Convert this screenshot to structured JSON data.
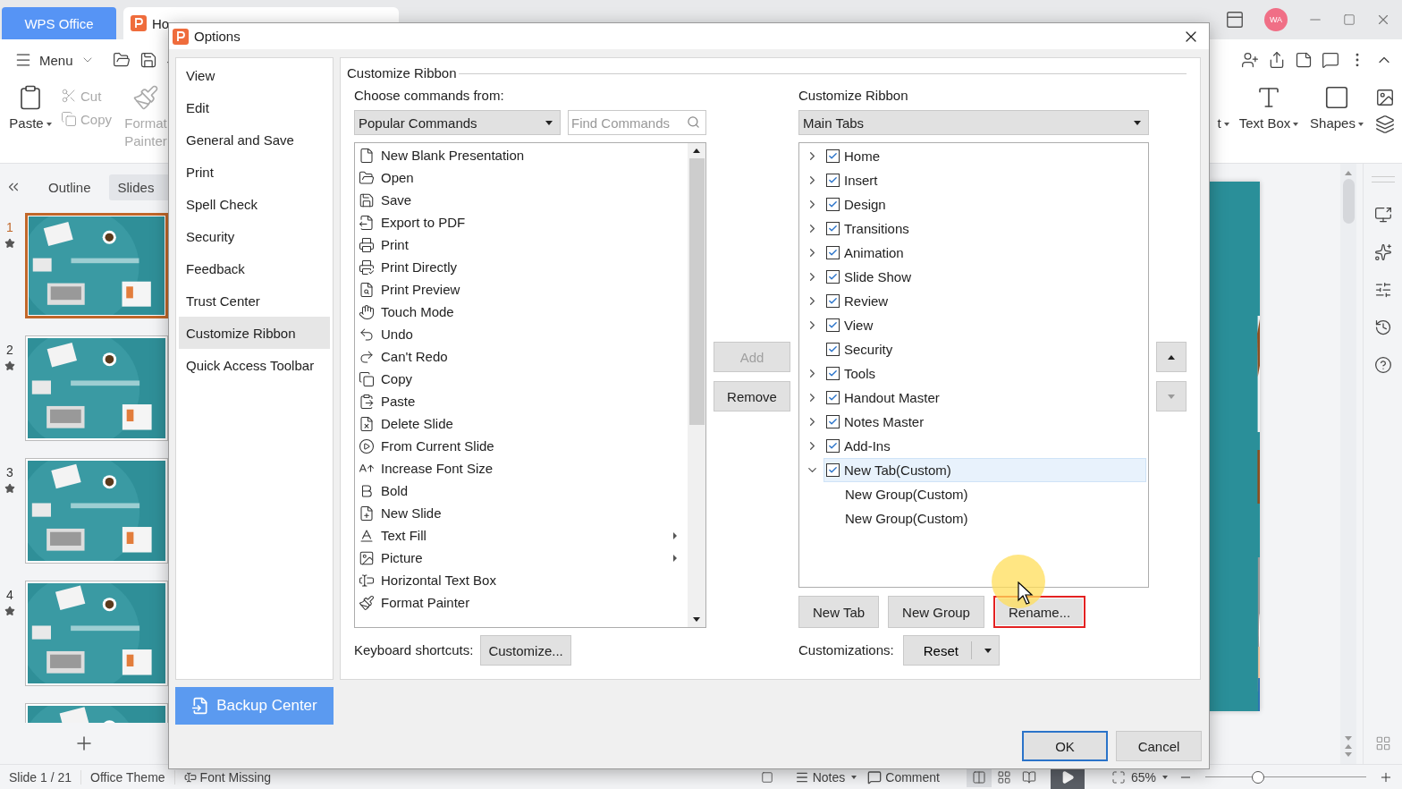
{
  "app_tabs": [
    {
      "kind": "home",
      "label": "WPS Office"
    },
    {
      "kind": "document",
      "label": "Ho"
    }
  ],
  "account": {
    "initials": "WA"
  },
  "menu": {
    "label": "Menu"
  },
  "ribbon": {
    "left": [
      {
        "kind": "large",
        "label": "Paste",
        "dropdown": true,
        "disabled": false
      },
      {
        "kind": "small",
        "label": "Cut",
        "disabled": true
      },
      {
        "kind": "small",
        "label": "Copy",
        "disabled": true
      },
      {
        "kind": "large",
        "label": "Format Painter",
        "disabled": true
      }
    ],
    "right": [
      {
        "label": "t",
        "dropdown": true
      },
      {
        "label": "Text Box",
        "dropdown": true
      },
      {
        "label": "Shapes",
        "dropdown": true
      }
    ]
  },
  "panel_tabs": [
    {
      "label": "Outline",
      "selected": false
    },
    {
      "label": "Slides",
      "selected": true
    }
  ],
  "slides": [
    {
      "number": "1",
      "selected": true
    },
    {
      "number": "2",
      "selected": false
    },
    {
      "number": "3",
      "selected": false
    },
    {
      "number": "4",
      "selected": false
    },
    {
      "selected": false
    }
  ],
  "status_bar": {
    "slide": "Slide 1 / 21",
    "theme": "Office Theme",
    "font_missing": "Font Missing",
    "notes": "Notes",
    "comment": "Comment",
    "views": [
      {
        "selected": true
      },
      {
        "selected": false
      },
      {
        "selected": false
      }
    ],
    "zoom": "65%",
    "zoom_slider": {
      "level": 0.33
    }
  },
  "dialog": {
    "title": "Options",
    "nav": [
      {
        "label": "View",
        "selected": false
      },
      {
        "label": "Edit",
        "selected": false
      },
      {
        "label": "General and Save",
        "selected": false
      },
      {
        "label": "Print",
        "selected": false
      },
      {
        "label": "Spell Check",
        "selected": false
      },
      {
        "label": "Security",
        "selected": false
      },
      {
        "label": "Feedback",
        "selected": false
      },
      {
        "label": "Trust Center",
        "selected": false
      },
      {
        "label": "Customize Ribbon",
        "selected": true
      },
      {
        "label": "Quick Access Toolbar",
        "selected": false
      }
    ],
    "backup_button": "Backup Center",
    "section_title": "Customize Ribbon",
    "commands_label": "Choose commands from:",
    "commands_source": "Popular Commands",
    "search": {
      "placeholder": "Find Commands"
    },
    "commands": [
      {
        "label": "New Blank Presentation",
        "submenu": false
      },
      {
        "label": "Open",
        "submenu": false
      },
      {
        "label": "Save",
        "submenu": false
      },
      {
        "label": "Export to PDF",
        "submenu": false
      },
      {
        "label": "Print",
        "submenu": false
      },
      {
        "label": "Print Directly",
        "submenu": false
      },
      {
        "label": "Print Preview",
        "submenu": false
      },
      {
        "label": "Touch Mode",
        "submenu": false
      },
      {
        "label": "Undo",
        "submenu": false
      },
      {
        "label": "Can't Redo",
        "submenu": false
      },
      {
        "label": "Copy",
        "submenu": false
      },
      {
        "label": "Paste",
        "submenu": false
      },
      {
        "label": "Delete Slide",
        "submenu": false
      },
      {
        "label": "From Current Slide",
        "submenu": false
      },
      {
        "label": "Increase Font Size",
        "submenu": false
      },
      {
        "label": "Bold",
        "submenu": false
      },
      {
        "label": "New Slide",
        "submenu": false
      },
      {
        "label": "Text Fill",
        "submenu": true
      },
      {
        "label": "Picture",
        "submenu": true
      },
      {
        "label": "Horizontal Text Box",
        "submenu": false
      },
      {
        "label": "Format  Painter",
        "submenu": false
      }
    ],
    "add_button": {
      "label": "Add",
      "disabled": true
    },
    "remove_button": {
      "label": "Remove",
      "disabled": false
    },
    "ribbon_label": "Customize Ribbon",
    "ribbon_source": "Main Tabs",
    "tabs_tree": [
      {
        "label": "Home",
        "checked": true,
        "expanded": false,
        "selected": false
      },
      {
        "label": "Insert",
        "checked": true,
        "expanded": false,
        "selected": false
      },
      {
        "label": "Design",
        "checked": true,
        "expanded": false,
        "selected": false
      },
      {
        "label": "Transitions",
        "checked": true,
        "expanded": false,
        "selected": false
      },
      {
        "label": "Animation",
        "checked": true,
        "expanded": false,
        "selected": false
      },
      {
        "label": "Slide Show",
        "checked": true,
        "expanded": false,
        "selected": false
      },
      {
        "label": "Review",
        "checked": true,
        "expanded": false,
        "selected": false
      },
      {
        "label": "View",
        "checked": true,
        "expanded": false,
        "selected": false
      },
      {
        "label": "Security",
        "checked": true,
        "selected": false
      },
      {
        "label": "Tools",
        "checked": true,
        "expanded": false,
        "selected": false
      },
      {
        "label": "Handout Master",
        "checked": true,
        "expanded": false,
        "selected": false
      },
      {
        "label": "Notes Master",
        "checked": true,
        "expanded": false,
        "selected": false
      },
      {
        "label": "Add-Ins",
        "checked": true,
        "expanded": false,
        "selected": false
      },
      {
        "label": "New Tab(Custom)",
        "checked": true,
        "expanded": true,
        "selected": true,
        "children": [
          {
            "label": "New Group(Custom)",
            "selected": false
          },
          {
            "label": "New Group(Custom)",
            "selected": false
          }
        ]
      }
    ],
    "move_up": {
      "disabled": false
    },
    "move_down": {
      "disabled": true
    },
    "tree_buttons": [
      {
        "label": "New Tab",
        "highlighted": false
      },
      {
        "label": "New Group",
        "highlighted": false
      },
      {
        "label": "Rename...",
        "highlighted": true
      }
    ],
    "shortcuts_label": "Keyboard shortcuts:",
    "customize_button": "Customize...",
    "customizations_label": "Customizations:",
    "reset_button": "Reset",
    "ok": {
      "label": "OK",
      "default": true
    },
    "cancel": {
      "label": "Cancel",
      "default": false
    }
  }
}
